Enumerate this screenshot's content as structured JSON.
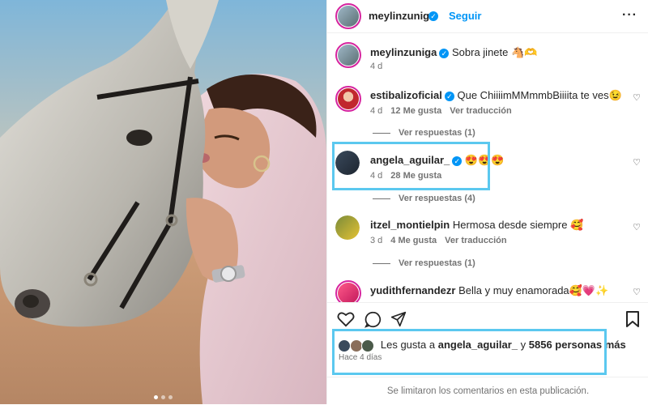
{
  "header": {
    "username": "meylinzuniga",
    "follow_label": "Seguir",
    "more_icon": "more-horizontal-icon"
  },
  "caption": {
    "username": "meylinzuniga",
    "text": "Sobra jinete 🐴🫶",
    "time": "4 d"
  },
  "comments": [
    {
      "username": "estibalizoficial",
      "verified": true,
      "text": "Que ChiiiimMMmmbBiiiita te ves😉",
      "time": "4 d",
      "likes": "12 Me gusta",
      "translate": "Ver traducción",
      "replies": "Ver respuestas (1)"
    },
    {
      "username": "angela_aguilar_",
      "verified": true,
      "text": "😍😍😍",
      "time": "4 d",
      "likes": "28 Me gusta",
      "translate": "",
      "replies": "Ver respuestas (4)"
    },
    {
      "username": "itzel_montielpin",
      "verified": false,
      "text": "Hermosa desde siempre 🥰",
      "time": "3 d",
      "likes": "4 Me gusta",
      "translate": "Ver traducción",
      "replies": "Ver respuestas (1)"
    },
    {
      "username": "yudithfernandezr",
      "verified": false,
      "text": "Bella y muy enamorada🥰💗✨",
      "time": "",
      "likes": "",
      "translate": "",
      "replies": ""
    }
  ],
  "likes": {
    "prefix": "Les gusta a",
    "user": "angela_aguilar_",
    "connector": "y",
    "others": "5856 personas más"
  },
  "date": "Hace 4 días",
  "comments_limited": "Se limitaron los comentarios en esta publicación.",
  "colors": {
    "accent": "#0095f6",
    "highlight": "#5bc8ef",
    "muted": "#737373"
  }
}
